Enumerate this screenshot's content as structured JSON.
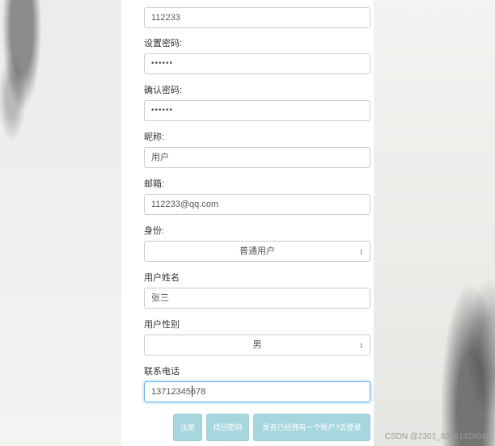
{
  "form": {
    "username_value": "112233",
    "password_label": "设置密码:",
    "password_value": "••••••",
    "confirm_password_label": "确认密码:",
    "confirm_password_value": "••••••",
    "nickname_label": "昵称:",
    "nickname_value": "用户",
    "email_label": "邮箱:",
    "email_value": "112233@qq.com",
    "identity_label": "身份:",
    "identity_selected": "普通用户",
    "real_name_label": "用户姓名",
    "real_name_value": "张三",
    "gender_label": "用户性别",
    "gender_selected": "男",
    "phone_label": "联系电话",
    "phone_value": "13712345678"
  },
  "buttons": {
    "register": "注册",
    "forgot_password": "找回密码",
    "has_account_login": "是否已经拥有一个账户?去登录"
  },
  "watermark": "CSDN @2301_82241428046",
  "icons": {
    "select_arrow": "sort-updown-icon"
  },
  "colors": {
    "button_bg": "#a8d6de",
    "focus_border": "#66afe9"
  }
}
